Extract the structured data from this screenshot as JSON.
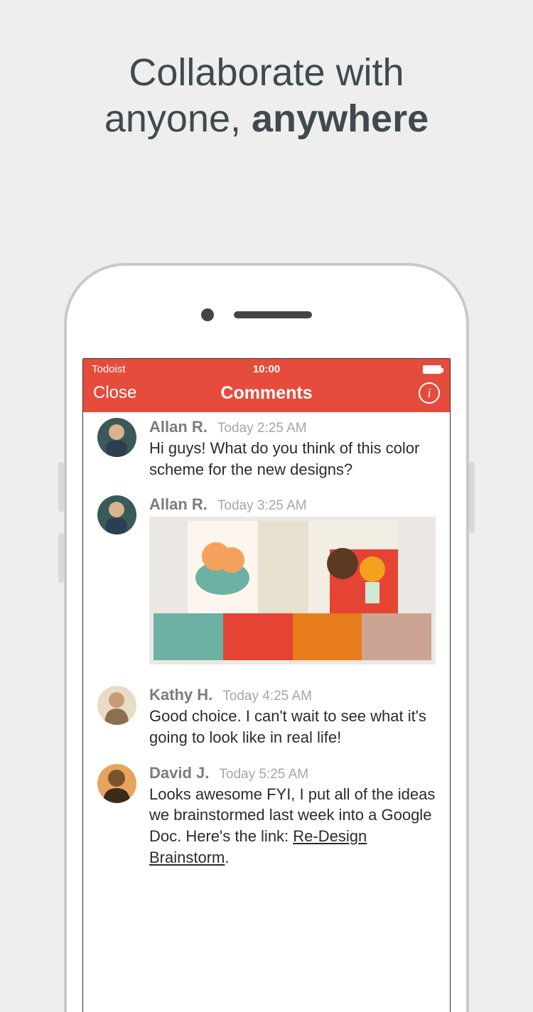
{
  "headline": {
    "line1": "Collaborate with",
    "line2_a": "anyone, ",
    "line2_b": "anywhere"
  },
  "status": {
    "carrier": "Todoist",
    "clock": "10:00"
  },
  "nav": {
    "close": "Close",
    "title": "Comments"
  },
  "comments": [
    {
      "author": "Allan R.",
      "time": "Today 2:25 AM",
      "text": "Hi guys! What do you think of this color scheme for the new designs?",
      "avatar_colors": [
        "#3a5a5a",
        "#d9b38c"
      ]
    },
    {
      "author": "Allan R.",
      "time": "Today 3:25 AM",
      "attachment": true,
      "avatar_colors": [
        "#3a5a5a",
        "#d9b38c"
      ]
    },
    {
      "author": "Kathy H.",
      "time": "Today 4:25 AM",
      "text": "Good choice. I can't wait to see what it's going to look like in real life!",
      "avatar_colors": [
        "#8c6f50",
        "#efd7b0"
      ]
    },
    {
      "author": "David J.",
      "time": "Today 5:25 AM",
      "text_prefix": "Looks awesome FYI, I put all of the ideas we brainstormed last week into a Google Doc. Here's the link: ",
      "link_text": "Re-Design Brainstorm",
      "text_suffix": ".",
      "avatar_colors": [
        "#e6a55c",
        "#3c2a1a"
      ]
    }
  ],
  "palette": {
    "swatches": [
      "#6db1a4",
      "#e54434",
      "#e77c1a",
      "#cba494"
    ]
  }
}
